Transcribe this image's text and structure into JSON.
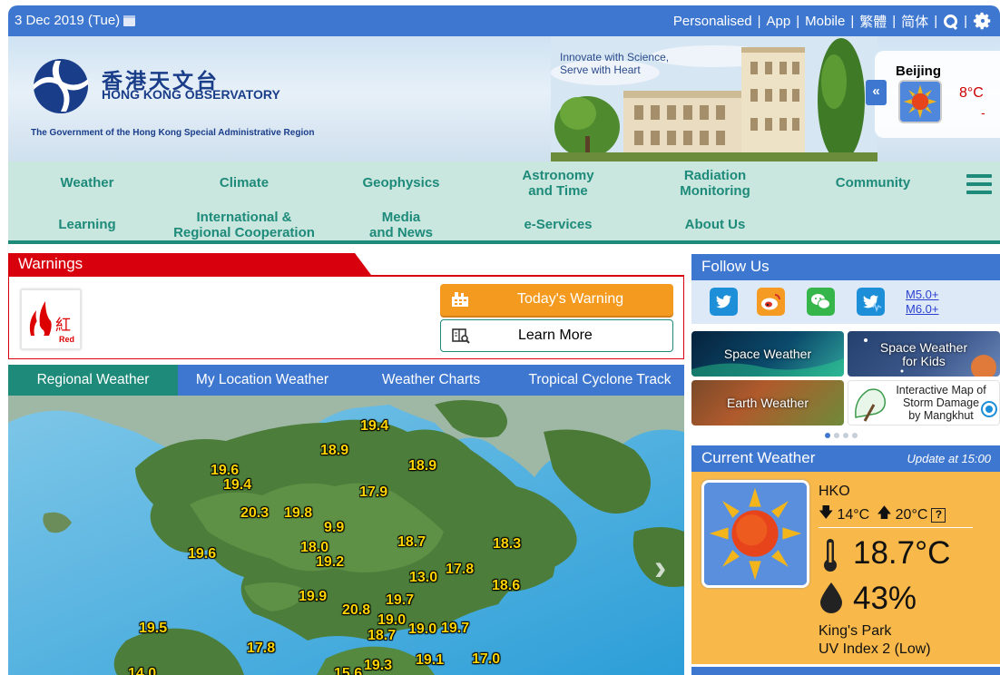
{
  "topbar": {
    "date": "3 Dec 2019 (Tue)",
    "links": [
      "Personalised",
      "App",
      "Mobile",
      "繁體",
      "简体"
    ]
  },
  "banner": {
    "org_cn": "香港天文台",
    "org_en": "HONG KONG OBSERVATORY",
    "government_line": "The Government of the Hong Kong Special Administrative Region",
    "slogan_line1": "Innovate with Science,",
    "slogan_line2": "Serve with Heart",
    "city": {
      "name": "Beijing",
      "temp": "8°C",
      "extra": "-",
      "icon": "sunny-icon"
    }
  },
  "nav": {
    "row1": [
      "Weather",
      "Climate",
      "Geophysics",
      "Astronomy\nand Time",
      "Radiation\nMonitoring",
      "Community"
    ],
    "row2": [
      "Learning",
      "International &\nRegional Cooperation",
      "Media\nand News",
      "e-Services",
      "About Us"
    ]
  },
  "warnings": {
    "title": "Warnings",
    "signal_label_cn": "紅",
    "signal_label_en": "Red",
    "todays_warning": "Today's Warning",
    "learn_more": "Learn More"
  },
  "weather_tabs": [
    "Regional Weather",
    "My Location Weather",
    "Weather Charts",
    "Tropical Cyclone Track"
  ],
  "map_temperatures": [
    "19.4",
    "18.9",
    "18.9",
    "19.6",
    "19.4",
    "17.9",
    "20.3",
    "19.8",
    "9.9",
    "19.6",
    "18.0",
    "19.2",
    "18.7",
    "18.3",
    "17.8",
    "13.0",
    "18.6",
    "19.9",
    "20.8",
    "19.7",
    "19.0",
    "18.7",
    "19.0",
    "19.7",
    "19.5",
    "17.8",
    "19.1",
    "17.0",
    "19.3",
    "14.0",
    "15.6"
  ],
  "follow_us": {
    "title": "Follow Us",
    "icons": [
      "twitter-icon",
      "weibo-icon",
      "wechat-icon",
      "twitter-quake-icon"
    ],
    "quake_link_line1": "M5.0+",
    "quake_link_line2": "M6.0+"
  },
  "tiles": {
    "space_weather": "Space Weather",
    "space_weather_kids_line1": "Space Weather",
    "space_weather_kids_line2": "for Kids",
    "earth_weather": "Earth Weather",
    "storm_map_line1": "Interactive Map of",
    "storm_map_line2": "Storm Damage",
    "storm_map_line3": "by Mangkhut"
  },
  "current_weather": {
    "title": "Current Weather",
    "update": "Update at 15:00",
    "station": "HKO",
    "min": "14°C",
    "max": "20°C",
    "temperature": "18.7°C",
    "humidity": "43%",
    "place": "King's Park",
    "uv": "UV Index 2 (Low)"
  },
  "colors": {
    "brand_blue": "#3e77d0",
    "nav_green": "#1e8a7a",
    "warning_red": "#d8000c",
    "warning_orange": "#f49b1f",
    "current_weather_bg": "#f8b84a"
  }
}
